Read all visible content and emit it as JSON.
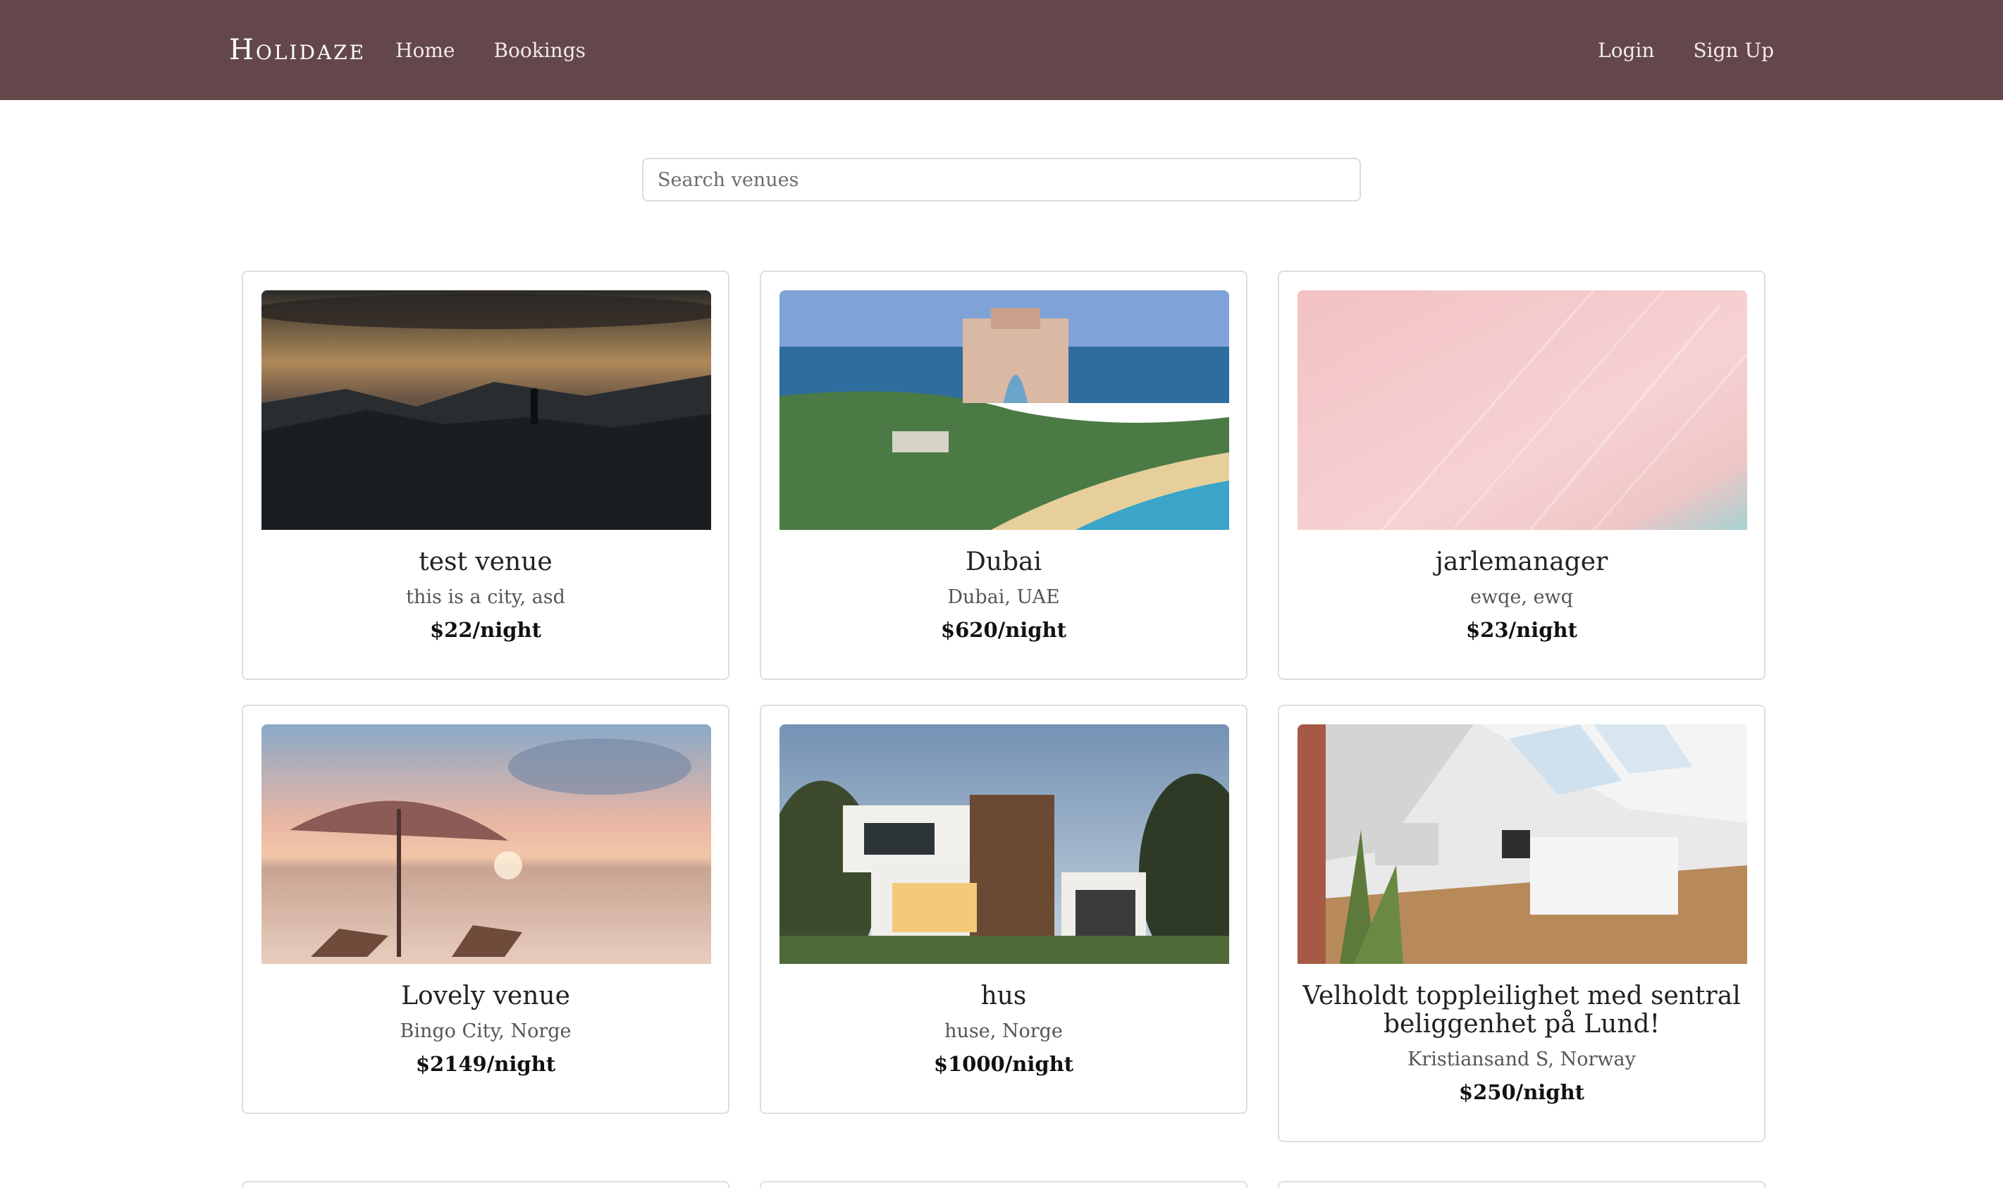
{
  "header": {
    "brand": "Holidaze",
    "nav_left": [
      "Home",
      "Bookings"
    ],
    "nav_right": [
      "Login",
      "Sign Up"
    ]
  },
  "search": {
    "placeholder": "Search venues",
    "value": ""
  },
  "venues": [
    {
      "name": "test venue",
      "location": "this is a city, asd",
      "price": "$22/night",
      "image": "mountain-sunset-silhouette"
    },
    {
      "name": "Dubai",
      "location": "Dubai, UAE",
      "price": "$620/night",
      "image": "beach-resort-hotel"
    },
    {
      "name": "jarlemanager",
      "location": "ewqe, ewq",
      "price": "$23/night",
      "image": "pink-abstract-texture"
    },
    {
      "name": "Lovely venue",
      "location": "Bingo City, Norge",
      "price": "$2149/night",
      "image": "beach-umbrella-sunset"
    },
    {
      "name": "hus",
      "location": "huse, Norge",
      "price": "$1000/night",
      "image": "modern-house"
    },
    {
      "name": "Velholdt toppleilighet med sentral beliggenhet på Lund!",
      "location": "Kristiansand S, Norway",
      "price": "$250/night",
      "image": "attic-apartment-interior"
    }
  ],
  "colors": {
    "navbar": "#64474b"
  }
}
